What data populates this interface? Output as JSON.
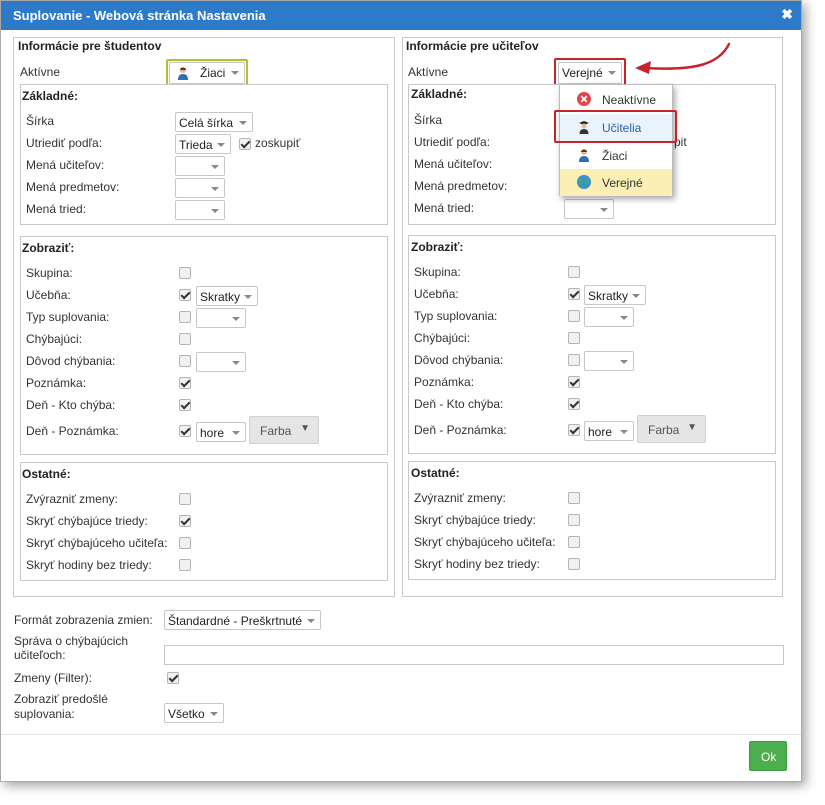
{
  "window": {
    "title": "Suplovanie - Webová stránka Nastavenia",
    "close_glyph": "✖"
  },
  "students": {
    "header": "Informácie pre študentov",
    "active_label": "Aktívne",
    "active_value": "Žiaci",
    "basic": {
      "header": "Základné:",
      "width_label": "Šírka",
      "width_value": "Celá šírka",
      "sort_label": "Utriediť podľa:",
      "sort_value": "Trieda",
      "group_label": "zoskupiť",
      "group_checked": true,
      "teacher_names_label": "Mená učiteľov:",
      "subject_names_label": "Mená predmetov:",
      "class_names_label": "Mená tried:"
    },
    "show": {
      "header": "Zobraziť:",
      "rows": [
        {
          "label": "Skupina:",
          "checked": false
        },
        {
          "label": "Učebňa:",
          "checked": true,
          "select": "Skratky"
        },
        {
          "label": "Typ suplovania:",
          "checked": false,
          "select": ""
        },
        {
          "label": "Chýbajúci:",
          "checked": false
        },
        {
          "label": "Dôvod chýbania:",
          "checked": false,
          "select": ""
        },
        {
          "label": "Poznámka:",
          "checked": true
        },
        {
          "label": "Deň - Kto chýba:",
          "checked": true
        },
        {
          "label": "Deň - Poznámka:",
          "checked": true,
          "select": "hore",
          "button": "Farba"
        }
      ]
    },
    "other": {
      "header": "Ostatné:",
      "rows": [
        {
          "label": "Zvýrazniť zmeny:",
          "checked": false
        },
        {
          "label": "Skryť chýbajúce triedy:",
          "checked": true
        },
        {
          "label": "Skryť chýbajúceho učiteľa:",
          "checked": false
        },
        {
          "label": "Skryť hodiny bez triedy:",
          "checked": false
        }
      ]
    }
  },
  "teachers": {
    "header": "Informácie pre učiteľov",
    "active_label": "Aktívne",
    "active_value": "Verejné",
    "basic": {
      "header": "Základné:",
      "width_label": "Šírka",
      "sort_label": "Utriediť podľa:",
      "group_label_fragment": "pit",
      "teacher_names_label": "Mená učiteľov:",
      "subject_names_label": "Mená predmetov:",
      "class_names_label": "Mená tried:"
    },
    "show": {
      "header": "Zobraziť:",
      "rows": [
        {
          "label": "Skupina:",
          "checked": false
        },
        {
          "label": "Učebňa:",
          "checked": true,
          "select": "Skratky"
        },
        {
          "label": "Typ suplovania:",
          "checked": false,
          "select": ""
        },
        {
          "label": "Chýbajúci:",
          "checked": false
        },
        {
          "label": "Dôvod chýbania:",
          "checked": false,
          "select": ""
        },
        {
          "label": "Poznámka:",
          "checked": true
        },
        {
          "label": "Deň - Kto chýba:",
          "checked": true
        },
        {
          "label": "Deň - Poznámka:",
          "checked": true,
          "select": "hore",
          "button": "Farba"
        }
      ]
    },
    "other": {
      "header": "Ostatné:",
      "rows": [
        {
          "label": "Zvýrazniť zmeny:",
          "checked": false
        },
        {
          "label": "Skryť chýbajúce triedy:",
          "checked": false
        },
        {
          "label": "Skryť chýbajúceho učiteľa:",
          "checked": false
        },
        {
          "label": "Skryť hodiny bez triedy:",
          "checked": false
        }
      ]
    }
  },
  "dropdown": {
    "options": [
      {
        "label": "Neaktívne",
        "icon": "inactive-icon"
      },
      {
        "label": "Učitelia",
        "icon": "teacher-icon",
        "highlighted": true
      },
      {
        "label": "Žiaci",
        "icon": "student-icon"
      },
      {
        "label": "Verejné",
        "icon": "globe-icon",
        "selected": true
      }
    ]
  },
  "bottom": {
    "format_label": "Formát zobrazenia zmien:",
    "format_value": "Štandardné - Preškrtnuté",
    "message_label_line1": "Správa o chýbajúcich",
    "message_label_line2": "učiteľoch:",
    "message_value": "",
    "filter_label": "Zmeny (Filter):",
    "filter_checked": true,
    "previous_label_line1": "Zobraziť predošlé",
    "previous_label_line2": "suplovania:",
    "previous_value": "Všetko"
  },
  "ok_label": "Ok",
  "colors": {
    "titlebar": "#2d7ac9",
    "ok": "#4cae4c",
    "highlight_green": "#a7c928",
    "highlight_red": "#c8232c",
    "selected_option": "#fcefb5"
  }
}
